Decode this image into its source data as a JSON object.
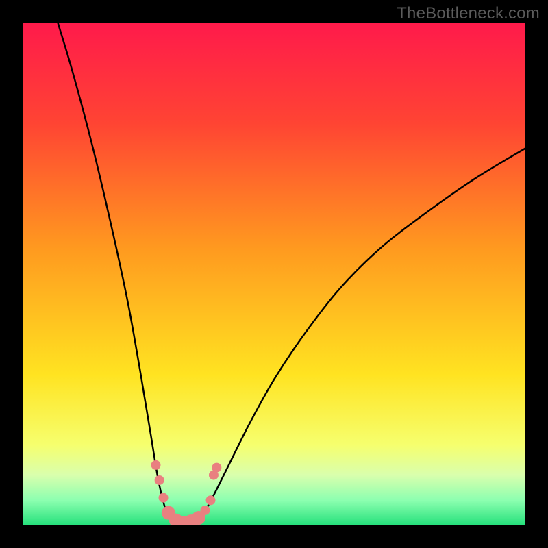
{
  "watermark": "TheBottleneck.com",
  "chart_data": {
    "type": "line",
    "title": "",
    "xlabel": "",
    "ylabel": "",
    "xlim": [
      0,
      100
    ],
    "ylim": [
      0,
      100
    ],
    "background_gradient": {
      "stops": [
        {
          "offset": 0.0,
          "color": "#ff1a4b"
        },
        {
          "offset": 0.2,
          "color": "#ff4433"
        },
        {
          "offset": 0.45,
          "color": "#ff9a1f"
        },
        {
          "offset": 0.7,
          "color": "#ffe321"
        },
        {
          "offset": 0.84,
          "color": "#f6ff6e"
        },
        {
          "offset": 0.9,
          "color": "#d9ffad"
        },
        {
          "offset": 0.95,
          "color": "#8cffb0"
        },
        {
          "offset": 1.0,
          "color": "#24e07b"
        }
      ]
    },
    "series": [
      {
        "name": "curve",
        "color": "#000000",
        "width": 2.5,
        "points": [
          {
            "x": 7.0,
            "y": 100.0
          },
          {
            "x": 10.0,
            "y": 90.0
          },
          {
            "x": 14.0,
            "y": 75.0
          },
          {
            "x": 18.0,
            "y": 58.0
          },
          {
            "x": 21.0,
            "y": 44.0
          },
          {
            "x": 23.5,
            "y": 30.0
          },
          {
            "x": 25.5,
            "y": 18.0
          },
          {
            "x": 27.0,
            "y": 9.0
          },
          {
            "x": 28.5,
            "y": 3.0
          },
          {
            "x": 30.0,
            "y": 0.5
          },
          {
            "x": 32.0,
            "y": 0.0
          },
          {
            "x": 34.0,
            "y": 0.5
          },
          {
            "x": 36.0,
            "y": 2.5
          },
          {
            "x": 38.0,
            "y": 6.0
          },
          {
            "x": 41.0,
            "y": 12.0
          },
          {
            "x": 45.0,
            "y": 20.0
          },
          {
            "x": 50.0,
            "y": 29.0
          },
          {
            "x": 56.0,
            "y": 38.0
          },
          {
            "x": 63.0,
            "y": 47.0
          },
          {
            "x": 71.0,
            "y": 55.0
          },
          {
            "x": 80.0,
            "y": 62.0
          },
          {
            "x": 90.0,
            "y": 69.0
          },
          {
            "x": 100.0,
            "y": 75.0
          }
        ]
      }
    ],
    "markers": {
      "color": "#e98080",
      "radius_small": 7,
      "radius_large": 10,
      "points": [
        {
          "x": 26.5,
          "y": 12.0,
          "r": "small"
        },
        {
          "x": 27.2,
          "y": 9.0,
          "r": "small"
        },
        {
          "x": 28.0,
          "y": 5.5,
          "r": "small"
        },
        {
          "x": 29.0,
          "y": 2.5,
          "r": "large"
        },
        {
          "x": 30.5,
          "y": 1.0,
          "r": "large"
        },
        {
          "x": 32.0,
          "y": 0.5,
          "r": "large"
        },
        {
          "x": 33.5,
          "y": 0.8,
          "r": "large"
        },
        {
          "x": 35.0,
          "y": 1.5,
          "r": "large"
        },
        {
          "x": 36.3,
          "y": 3.0,
          "r": "small"
        },
        {
          "x": 37.4,
          "y": 5.0,
          "r": "small"
        },
        {
          "x": 38.0,
          "y": 10.0,
          "r": "small"
        },
        {
          "x": 38.6,
          "y": 11.5,
          "r": "small"
        }
      ]
    }
  }
}
